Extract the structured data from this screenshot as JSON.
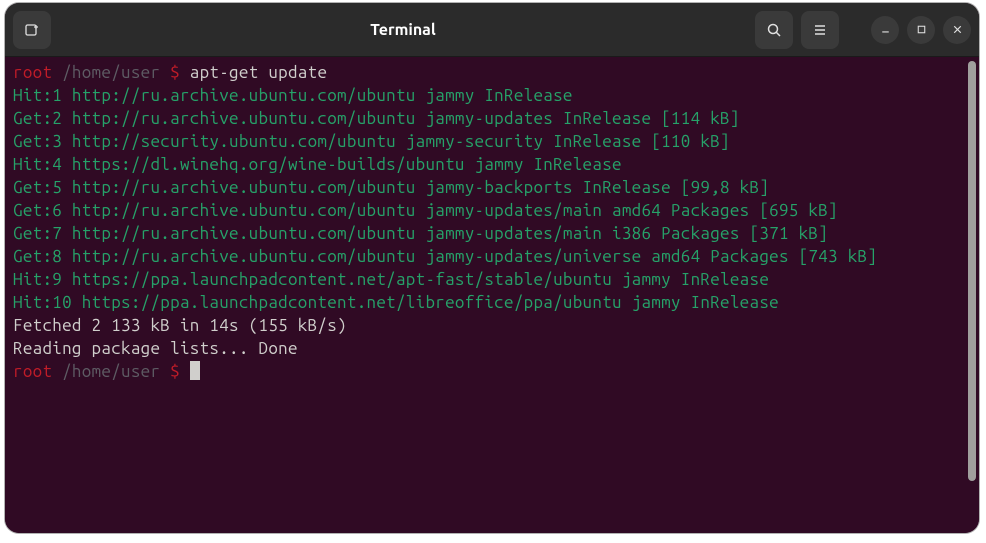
{
  "titlebar": {
    "title": "Terminal"
  },
  "prompt": {
    "user": "root",
    "path": " /home/user ",
    "symbol": "$",
    "command": "apt-get update"
  },
  "output": [
    "Hit:1 http://ru.archive.ubuntu.com/ubuntu jammy InRelease",
    "Get:2 http://ru.archive.ubuntu.com/ubuntu jammy-updates InRelease [114 kB]",
    "Get:3 http://security.ubuntu.com/ubuntu jammy-security InRelease [110 kB]",
    "Hit:4 https://dl.winehq.org/wine-builds/ubuntu jammy InRelease",
    "Get:5 http://ru.archive.ubuntu.com/ubuntu jammy-backports InRelease [99,8 kB]",
    "Get:6 http://ru.archive.ubuntu.com/ubuntu jammy-updates/main amd64 Packages [695 kB]",
    "Get:7 http://ru.archive.ubuntu.com/ubuntu jammy-updates/main i386 Packages [371 kB]",
    "Get:8 http://ru.archive.ubuntu.com/ubuntu jammy-updates/universe amd64 Packages [743 kB]",
    "Hit:9 https://ppa.launchpadcontent.net/apt-fast/stable/ubuntu jammy InRelease",
    "Hit:10 https://ppa.launchpadcontent.net/libreoffice/ppa/ubuntu jammy InRelease"
  ],
  "summary": [
    "Fetched 2 133 kB in 14s (155 kB/s)",
    "Reading package lists... Done"
  ],
  "prompt2": {
    "user": "root",
    "path": " /home/user ",
    "symbol": "$"
  }
}
